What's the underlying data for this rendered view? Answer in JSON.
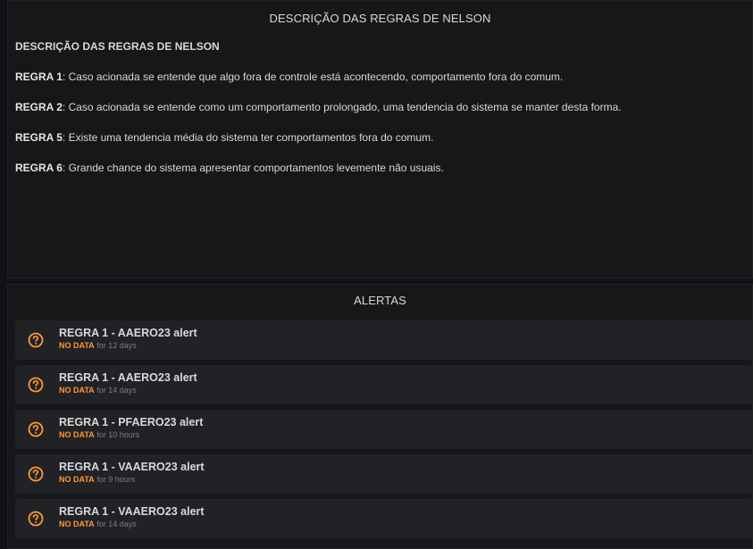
{
  "text_panel": {
    "title": "DESCRIÇÃO DAS REGRAS DE NELSON",
    "heading": "DESCRIÇÃO DAS REGRAS DE NELSON",
    "rules": [
      {
        "label": "REGRA 1",
        "text": ": Caso acionada se entende que algo fora de controle está acontecendo, comportamento fora do comum."
      },
      {
        "label": "REGRA 2",
        "text": ": Caso acionada se entende como um comportamento prolongado, uma tendencia do sistema se manter desta forma."
      },
      {
        "label": "REGRA 5",
        "text": ": Existe uma tendencia média do sistema ter comportamentos fora do comum."
      },
      {
        "label": "REGRA 6",
        "text": ": Grande chance do sistema apresentar comportamentos levemente não usuais."
      }
    ]
  },
  "alert_panel": {
    "title": "ALERTAS",
    "icon": "question-circle-icon",
    "state_color": "#ff9830",
    "alerts": [
      {
        "name": "REGRA 1 - AAERO23 alert",
        "state": "NO DATA",
        "time": "for 12 days"
      },
      {
        "name": "REGRA 1 - AAERO23 alert",
        "state": "NO DATA",
        "time": "for 14 days"
      },
      {
        "name": "REGRA 1 - PFAERO23 alert",
        "state": "NO DATA",
        "time": "for 10 hours"
      },
      {
        "name": "REGRA 1 - VAAERO23 alert",
        "state": "NO DATA",
        "time": "for 9 hours"
      },
      {
        "name": "REGRA 1 - VAAERO23 alert",
        "state": "NO DATA",
        "time": "for 14 days"
      }
    ]
  }
}
